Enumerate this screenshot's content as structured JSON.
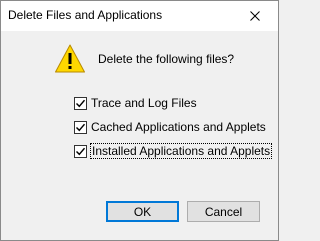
{
  "window": {
    "title": "Delete Files and Applications",
    "close_icon": "close-icon"
  },
  "dialog": {
    "icon": "warning-icon",
    "message": "Delete the following files?",
    "options": [
      {
        "label": "Trace and Log Files",
        "checked": true
      },
      {
        "label": "Cached Applications and Applets",
        "checked": true
      },
      {
        "label": "Installed Applications and Applets",
        "checked": true
      }
    ],
    "ok_label": "OK",
    "cancel_label": "Cancel"
  },
  "colors": {
    "warning_yellow": "#ffd800",
    "focus_blue": "#0078d7"
  }
}
